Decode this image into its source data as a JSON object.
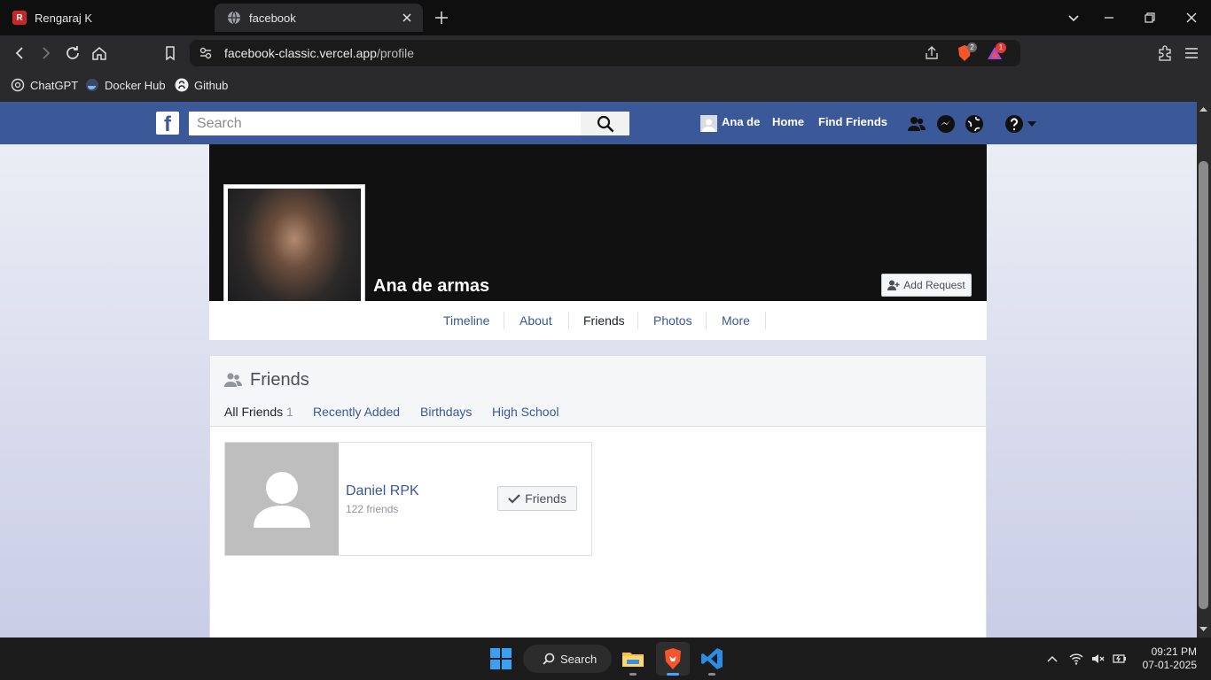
{
  "browser": {
    "tabs": [
      {
        "label": "Rengaraj K",
        "favicon_color": "#c62828",
        "active": false
      },
      {
        "label": "facebook",
        "active": true
      }
    ],
    "url": {
      "host": "facebook-classic.vercel.app",
      "path": "/profile"
    },
    "badges": {
      "brave_shields": "2",
      "rewards": "1"
    },
    "bookmarks": [
      {
        "label": "ChatGPT",
        "icon": "chatgpt-icon"
      },
      {
        "label": "Docker Hub",
        "icon": "docker-icon"
      },
      {
        "label": "Github",
        "icon": "github-icon"
      }
    ]
  },
  "fb": {
    "brand_color": "#3b5998",
    "logo": "f",
    "search_placeholder": "Search",
    "nav": {
      "user": "Ana de",
      "home": "Home",
      "find_friends": "Find Friends"
    },
    "profile": {
      "name": "Ana de armas",
      "add_request": "Add Request",
      "tabs": [
        "Timeline",
        "About",
        "Friends",
        "Photos",
        "More"
      ],
      "active_tab": "Friends"
    },
    "friends": {
      "title": "Friends",
      "tabs": {
        "all": "All Friends",
        "all_count": "1",
        "recent": "Recently Added",
        "birthdays": "Birthdays",
        "high_school": "High School"
      },
      "list": [
        {
          "name": "Daniel RPK",
          "sub": "122 friends",
          "button": "Friends"
        }
      ]
    }
  },
  "taskbar": {
    "search_label": "Search",
    "time": "09:21 PM",
    "date": "07-01-2025"
  }
}
